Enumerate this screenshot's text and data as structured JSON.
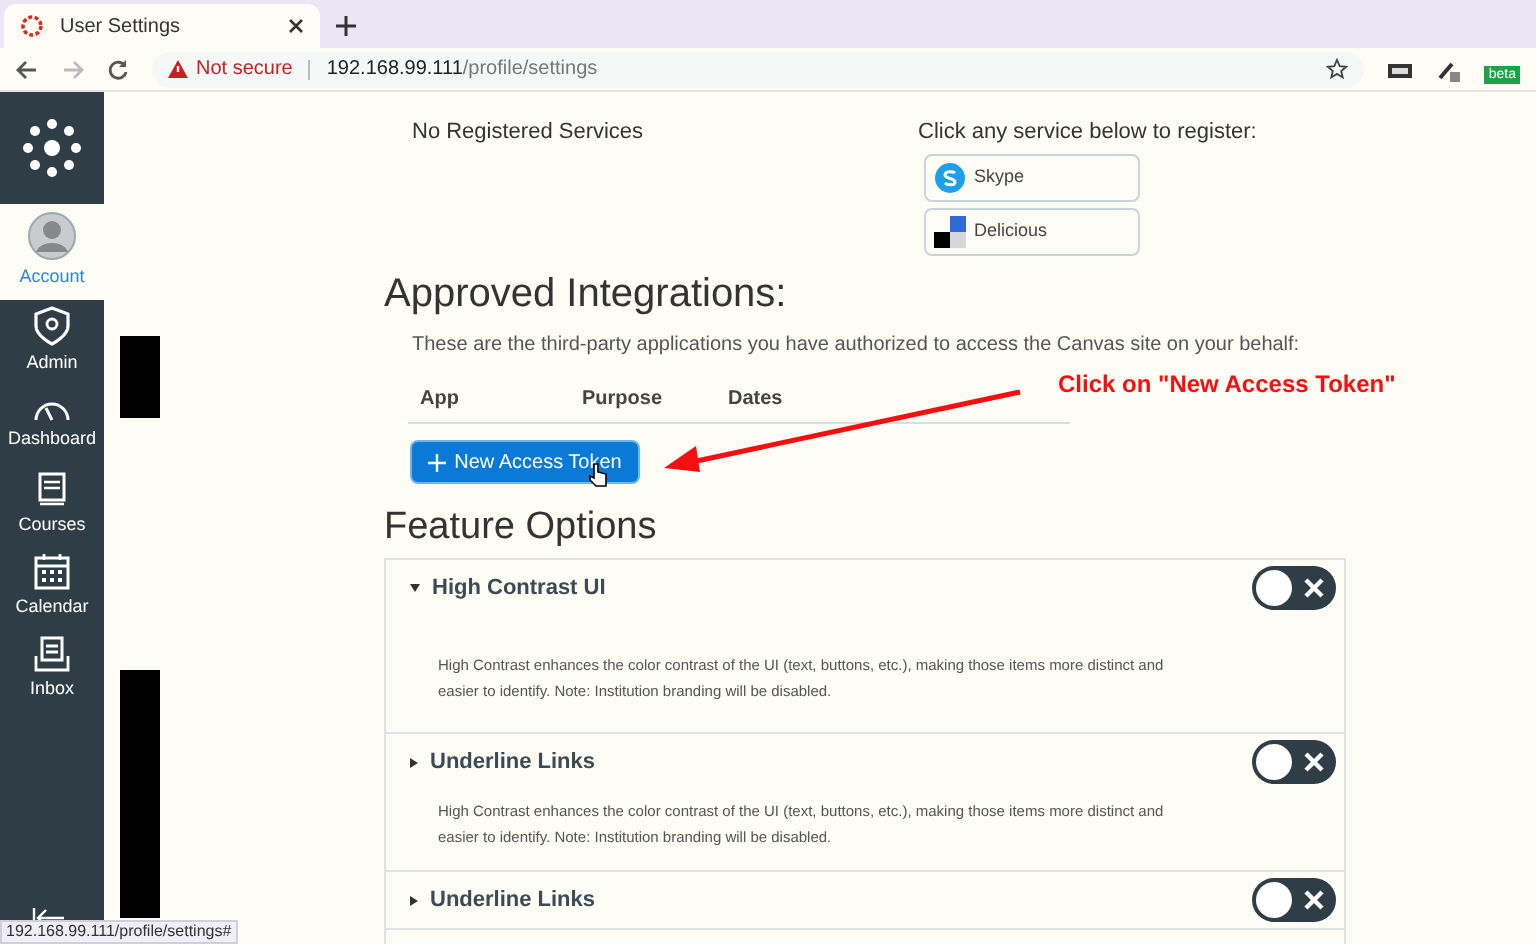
{
  "browser": {
    "tab_title": "User Settings",
    "security": "Not secure",
    "url_host": "192.168.99.111",
    "url_path": "/profile/settings",
    "extension_badge": "beta"
  },
  "sidebar": {
    "items": [
      {
        "label": "Account",
        "selected": true
      },
      {
        "label": "Admin",
        "selected": false
      },
      {
        "label": "Dashboard",
        "selected": false
      },
      {
        "label": "Courses",
        "selected": false
      },
      {
        "label": "Calendar",
        "selected": false
      },
      {
        "label": "Inbox",
        "selected": false
      }
    ]
  },
  "services": {
    "registered": "No Registered Services",
    "prompt": "Click any service below to register:",
    "buttons": [
      {
        "label": "Skype"
      },
      {
        "label": "Delicious"
      }
    ]
  },
  "integrations": {
    "heading": "Approved Integrations:",
    "description": "These are the third-party applications you have authorized to access the Canvas site on your behalf:",
    "columns": [
      "App",
      "Purpose",
      "Dates"
    ],
    "button": "New Access Token"
  },
  "annotation": "Click on \"New Access Token\"",
  "features": {
    "heading": "Feature Options",
    "rows": [
      {
        "title": "High Contrast UI",
        "expanded": true,
        "on": false,
        "description": "High Contrast enhances the color contrast of the UI (text, buttons, etc.), making those items more distinct and easier to identify. Note: Institution branding will be disabled."
      },
      {
        "title": "Underline Links",
        "expanded": false,
        "on": false,
        "description": "High Contrast enhances the color contrast of the UI (text, buttons, etc.), making those items more distinct and easier to identify. Note: Institution branding will be disabled."
      },
      {
        "title": "Underline Links",
        "expanded": false,
        "on": false
      }
    ]
  },
  "status_bar": "192.168.99.111/profile/settings#"
}
